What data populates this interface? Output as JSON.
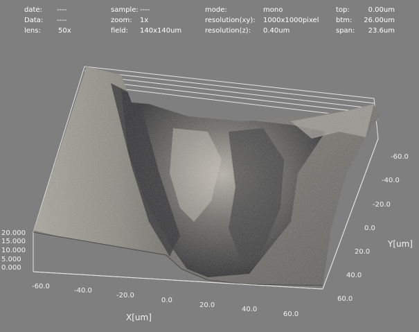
{
  "header": {
    "col1": [
      {
        "label": "date:",
        "value": "----"
      },
      {
        "label": "Data:",
        "value": "----"
      },
      {
        "label": "lens:",
        "value": "50x"
      }
    ],
    "col2": [
      {
        "label": "sample:",
        "value": "----"
      },
      {
        "label": "zoom:",
        "value": "1x"
      },
      {
        "label": "field:",
        "value": "140x140um"
      }
    ],
    "col3": [
      {
        "label": "mode:",
        "value": "mono"
      },
      {
        "label": "resolution(xy):",
        "value": "1000x1000pixel"
      },
      {
        "label": "resolution(z):",
        "value": "0.40um"
      }
    ],
    "col4": [
      {
        "label": "top:",
        "value": "0.00um"
      },
      {
        "label": "btm:",
        "value": "26.00um"
      },
      {
        "label": "span:",
        "value": "23.6um"
      }
    ]
  },
  "axes": {
    "x_label": "X[um]",
    "y_label": "Y[um]",
    "x_ticks": [
      "-60.0",
      "-40.0",
      "-20.0",
      "0.0",
      "20.0",
      "40.0",
      "60.0"
    ],
    "y_ticks": [
      "-60.0",
      "-40.0",
      "-20.0",
      "0.0",
      "20.0",
      "40.0",
      "60.0"
    ],
    "z_ticks": [
      "20.000",
      "15.000",
      "10.000",
      "5.000",
      "0.000"
    ]
  },
  "colors": {
    "background": "#7f7f7f",
    "text": "#ffffff",
    "frame_line": "#e6e6e6"
  }
}
